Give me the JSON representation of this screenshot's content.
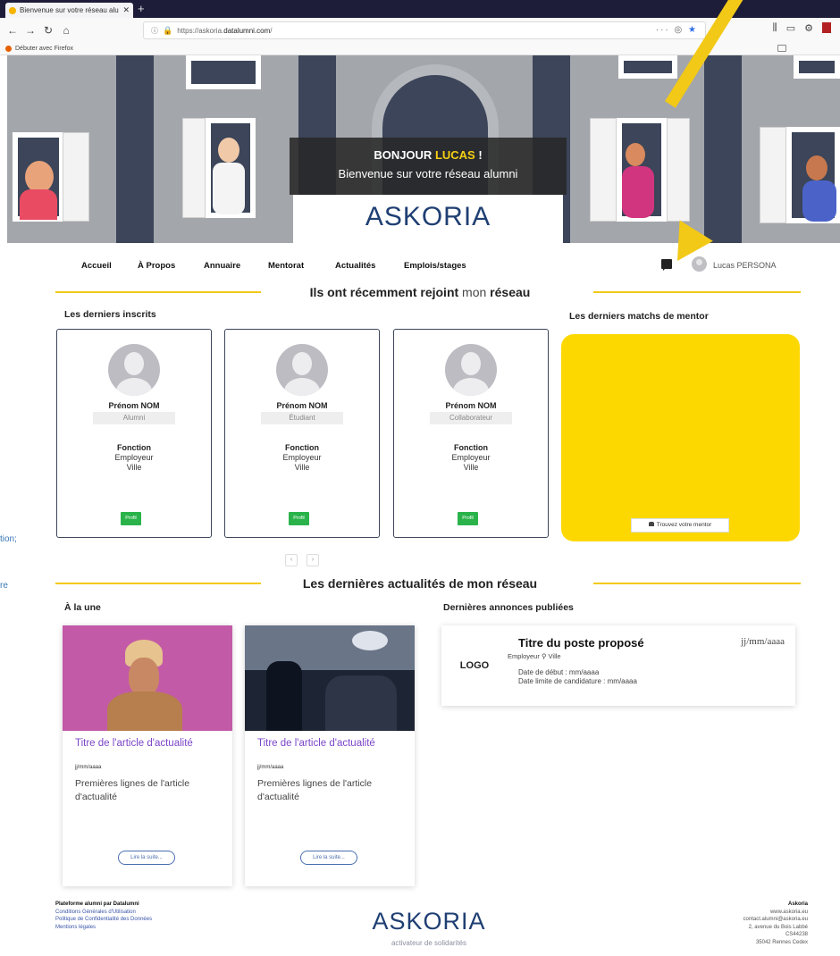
{
  "browser": {
    "tab_title": "Bienvenue sur votre réseau alu",
    "tab_close": "✕",
    "new_tab": "+",
    "url_prefix": "https://askoria.",
    "url_domain": "datalumni.com",
    "url_suffix": "/",
    "url_actions": "···",
    "bookmark": "Débuter avec Firefox"
  },
  "hero": {
    "greeting_prefix": "BONJOUR ",
    "greeting_name": "LUCAS",
    "greeting_suffix": " !",
    "welcome": "Bienvenue sur votre réseau alumni",
    "logo": "ASKORIA"
  },
  "nav": {
    "items": [
      "Accueil",
      "À Propos",
      "Annuaire",
      "Mentorat",
      "Actualités",
      "Emplois/stages"
    ],
    "username": "Lucas PERSONA"
  },
  "members_section": {
    "title_a": "Ils ont récemment rejoint",
    "title_b": "mon",
    "title_c": "réseau",
    "left_head": "Les derniers inscrits",
    "right_head": "Les derniers matchs de mentor",
    "cards": [
      {
        "name": "Prénom NOM",
        "role": "Alumni",
        "fonction": "Fonction",
        "employer": "Employeur",
        "city": "Ville",
        "button": "Profil"
      },
      {
        "name": "Prénom NOM",
        "role": "Étudiant",
        "fonction": "Fonction",
        "employer": "Employeur",
        "city": "Ville",
        "button": "Profil"
      },
      {
        "name": "Prénom NOM",
        "role": "Collaborateur",
        "fonction": "Fonction",
        "employer": "Employeur",
        "city": "Ville",
        "button": "Profil"
      }
    ],
    "pager_prev": "‹",
    "pager_next": "›",
    "mentor_button": "Trouvez votre mentor"
  },
  "news_section": {
    "title": "Les dernières actualités de mon réseau",
    "left_head": "À la une",
    "right_head": "Dernières annonces publiées",
    "articles": [
      {
        "title": "Titre de l'article d'actualité",
        "date": "jj/mm/aaaa",
        "excerpt": "Premières lignes de l'article d'actualité",
        "more": "Lire la suite..."
      },
      {
        "title": "Titre de l'article d'actualité",
        "date": "jj/mm/aaaa",
        "excerpt": "Premières lignes de l'article d'actualité",
        "more": "Lire la suite..."
      }
    ],
    "job": {
      "logo": "LOGO",
      "title": "Titre du poste proposé",
      "date": "jj/mm/aaaa",
      "employer": "Employeur",
      "city": "Ville",
      "start": "Date de début : mm/aaaa",
      "deadline": "Date limite de candidature : mm/aaaa"
    }
  },
  "footer": {
    "left_title": "Plateforme alumni par Datalumni",
    "links": [
      "Conditions Générales d'Utilisation",
      "Politique de Confidentialité des Données",
      "Mentions légales"
    ],
    "logo": "ASKORIA",
    "tagline": "activateur de solidarités",
    "right_title": "Askoria",
    "right_lines": [
      "www.askoria.eu",
      "contact.alumni@askoria.eu",
      "2, avenue du Bois Labbé",
      "CS44238",
      "35042 Rennes Cedex"
    ]
  },
  "side_fragments": [
    "tion;",
    "re"
  ],
  "colors": {
    "accent": "#f2c916",
    "mentor_bg": "#fdd800",
    "profile_button": "#2bb34b",
    "news_title": "#7b45c8",
    "navy": "#3c4559"
  }
}
